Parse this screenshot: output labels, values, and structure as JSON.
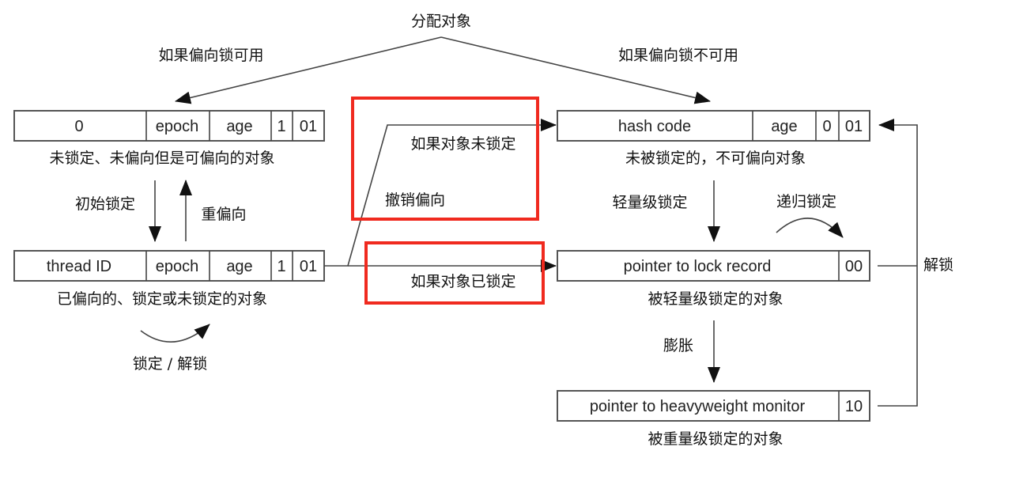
{
  "top": {
    "label": "分配对象",
    "left_branch": "如果偏向锁可用",
    "right_branch": "如果偏向锁不可用"
  },
  "unlocked_biasable": {
    "fields": [
      "0",
      "epoch",
      "age",
      "1",
      "01"
    ],
    "caption": "未锁定、未偏向但是可偏向的对象"
  },
  "initial_lock": "初始锁定",
  "rebias": "重偏向",
  "biased": {
    "fields": [
      "thread ID",
      "epoch",
      "age",
      "1",
      "01"
    ],
    "caption": "已偏向的、锁定或未锁定的对象"
  },
  "lock_unlock": "锁定 / 解锁",
  "revoke": {
    "if_unlocked": "如果对象未锁定",
    "revoke_bias": "撤销偏向",
    "if_locked": "如果对象已锁定"
  },
  "unlocked_nonbiasable": {
    "fields": [
      "hash code",
      "age",
      "0",
      "01"
    ],
    "caption": "未被锁定的，不可偏向对象"
  },
  "lightweight_lock": "轻量级锁定",
  "recursive_lock": "递归锁定",
  "lightweight": {
    "fields": [
      "pointer to lock record",
      "00"
    ],
    "caption": "被轻量级锁定的对象"
  },
  "inflate": "膨胀",
  "heavyweight": {
    "fields": [
      "pointer to heavyweight monitor",
      "10"
    ],
    "caption": "被重量级锁定的对象"
  },
  "unlock": "解锁",
  "colors": {
    "highlight": "#f02a1f",
    "line": "#444444"
  }
}
